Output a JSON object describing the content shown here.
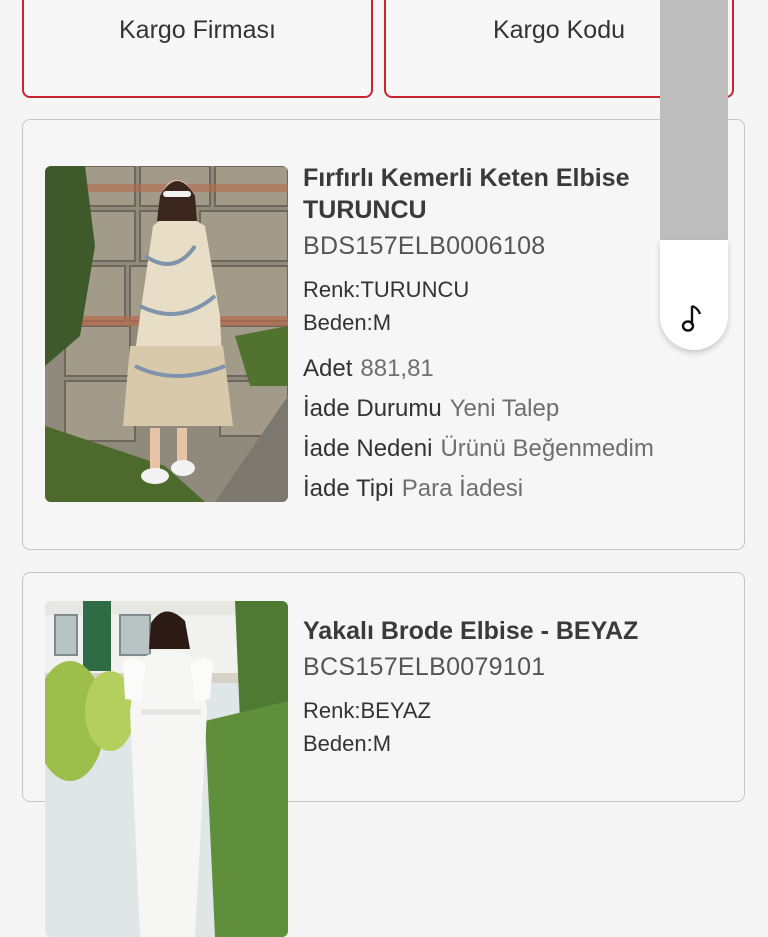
{
  "top_buttons": {
    "cargo_company": "Kargo Firması",
    "cargo_code": "Kargo Kodu"
  },
  "products": [
    {
      "name_line1": "Fırfırlı Kemerli Keten Elbise",
      "name_line2": "TURUNCU",
      "sku": "BDS157ELB0006108",
      "color": "Renk:TURUNCU",
      "size": "Beden:M",
      "qty_label": "Adet",
      "qty_value": "881,81",
      "status_label": "İade Durumu",
      "status_value": "Yeni Talep",
      "reason_label": "İade Nedeni",
      "reason_value": "Ürünü Beğenmedim",
      "type_label": "İade Tipi",
      "type_value": "Para İadesi"
    },
    {
      "name_line1": "Yakalı Brode Elbise - BEYAZ",
      "sku": "BCS157ELB0079101",
      "color": "Renk:BEYAZ",
      "size": "Beden:M"
    }
  ],
  "colors": {
    "accent": "#c9252f",
    "card_border": "#c6c6c6"
  },
  "icons": {
    "overlay": "music-note-icon"
  }
}
